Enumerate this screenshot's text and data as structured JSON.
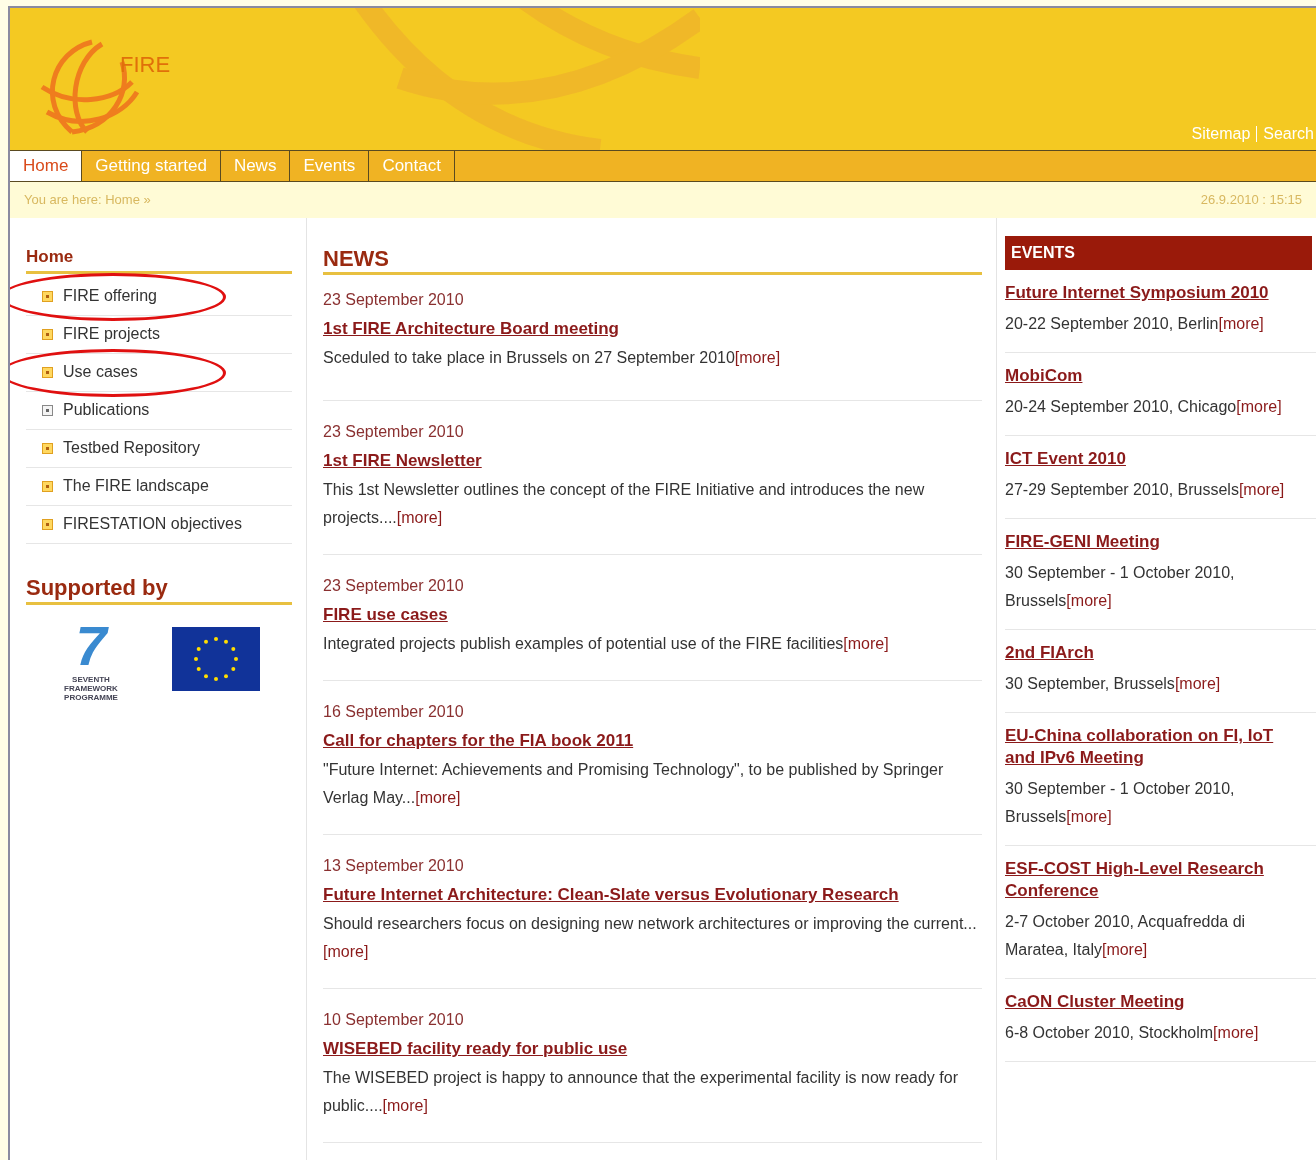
{
  "header": {
    "logo_text": "FIRE",
    "links": [
      "Sitemap",
      "Search"
    ]
  },
  "nav": [
    {
      "label": "Home",
      "selected": true
    },
    {
      "label": "Getting started",
      "selected": false
    },
    {
      "label": "News",
      "selected": false
    },
    {
      "label": "Events",
      "selected": false
    },
    {
      "label": "Contact",
      "selected": false
    }
  ],
  "breadcrumb": {
    "label": "You are here:",
    "path": "Home »",
    "datetime": "26.9.2010 : 15:15"
  },
  "sidebar": {
    "title": "Home",
    "items": [
      {
        "label": "FIRE offering",
        "circled": true,
        "dimmed": false
      },
      {
        "label": "FIRE projects",
        "circled": false,
        "dimmed": false
      },
      {
        "label": "Use cases",
        "circled": true,
        "dimmed": false
      },
      {
        "label": "Publications",
        "circled": false,
        "dimmed": true
      },
      {
        "label": "Testbed Repository",
        "circled": false,
        "dimmed": false
      },
      {
        "label": "The FIRE landscape",
        "circled": false,
        "dimmed": false
      },
      {
        "label": "FIRESTATION objectives",
        "circled": false,
        "dimmed": false
      }
    ],
    "supported_title": "Supported by",
    "supporters": [
      {
        "kind": "fp7",
        "mark": "7",
        "caption": "SEVENTH FRAMEWORK PROGRAMME"
      },
      {
        "kind": "eu"
      }
    ]
  },
  "news": {
    "title": "NEWS",
    "items": [
      {
        "date": "23 September 2010",
        "title": "1st FIRE Architecture Board meeting",
        "summary": "Sceduled to take place in Brussels on 27 September 2010",
        "more": "[more]"
      },
      {
        "date": "23 September 2010",
        "title": "1st FIRE Newsletter",
        "summary": "This 1st Newsletter outlines the concept of the FIRE Initiative and introduces the new projects....",
        "more": "[more]"
      },
      {
        "date": "23 September 2010",
        "title": "FIRE use cases",
        "summary": "Integrated projects publish examples of potential use of the FIRE facilities",
        "more": "[more]"
      },
      {
        "date": "16 September 2010",
        "title": "Call for chapters for the FIA book 2011",
        "summary": "\"Future Internet: Achievements and Promising Technology\", to be published by Springer Verlag May...",
        "more": "[more]"
      },
      {
        "date": "13 September 2010",
        "title": "Future Internet Architecture: Clean-Slate versus Evolutionary Research",
        "summary": "Should researchers focus on designing new network architectures or improving the current...",
        "more": "[more]"
      },
      {
        "date": "10 September 2010",
        "title": "WISEBED facility ready for public use",
        "summary": "The WISEBED project is happy to announce that the experimental facility is now ready for public....",
        "more": "[more]"
      }
    ]
  },
  "events": {
    "title": "EVENTS",
    "items": [
      {
        "title": "Future Internet Symposium 2010",
        "details": "20-22 September 2010, Berlin",
        "more": "[more]"
      },
      {
        "title": "MobiCom",
        "details": "20-24 September 2010, Chicago",
        "more": "[more]"
      },
      {
        "title": "ICT Event 2010",
        "details": "27-29 September 2010, Brussels",
        "more": "[more]"
      },
      {
        "title": "FIRE-GENI Meeting",
        "details": "30 September - 1 October 2010, Brussels",
        "more": "[more]"
      },
      {
        "title": "2nd FIArch",
        "details": "30 September, Brussels",
        "more": "[more]"
      },
      {
        "title": "EU-China collaboration on FI, IoT and IPv6 Meeting",
        "details": "30 September - 1 October 2010, Brussels",
        "more": "[more]"
      },
      {
        "title": "ESF-COST High-Level Research Conference",
        "details": "2-7 October 2010, Acquafredda di Maratea, Italy",
        "more": "[more]"
      },
      {
        "title": "CaON Cluster Meeting",
        "details": "6-8 October 2010, Stockholm",
        "more": "[more]"
      }
    ]
  }
}
